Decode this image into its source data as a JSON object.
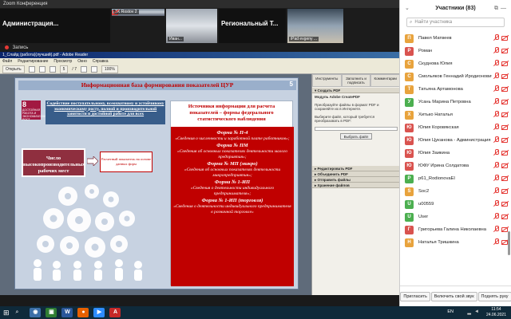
{
  "zoom": {
    "window_title": "Zoom Конференция",
    "tiles": [
      {
        "label": "Администрация...",
        "caption": ""
      },
      {
        "label": "",
        "caption": "TK Rostov 2"
      },
      {
        "label": "",
        "caption": "Иван..."
      },
      {
        "label": "Региональный Т...",
        "caption": ""
      },
      {
        "label": "",
        "caption": "iPad evgeny ..."
      }
    ],
    "recording_label": "Запись"
  },
  "reader": {
    "window_title": "1_Слайд (работа)(лучший).pdf - Adobe Reader",
    "menu": [
      "Файл",
      "Редактирование",
      "Просмотр",
      "Окно",
      "Справка"
    ],
    "toolbar": {
      "open": "Открыть",
      "page": "5",
      "page_total": "/ 7",
      "zoom": "100%"
    },
    "tools_tabs": [
      "Инструменты",
      "Заполнить и подписать",
      "Комментарии"
    ],
    "create_pdf": {
      "header": "▾ Создать PDF",
      "service": "Модуль Adobe CreatePDF",
      "description": "Преобразуйте файлы в формат PDF и сохраняйте их в Интернете.",
      "choose_label": "Выберите файл, который требуется преобразовать в PDF:",
      "button": "Выбрать файл"
    },
    "tool_items": [
      "▸ Редактировать PDF",
      "▸ Объединить PDF",
      "▸ Отправить файлы",
      "▸ Хранение файлов"
    ]
  },
  "slide": {
    "title": "Информационная база формирования показателей ЦУР",
    "number": "5",
    "sdg": {
      "num": "8",
      "text": "ДОСТОЙНАЯ РАБОТА И ЭКОНОМИЧЕСКИЙ РОСТ"
    },
    "goal_text": "Содействие поступательному, всеохватному и устойчивому экономическому росту, полной и производительной занятости и достойной работе для всех",
    "indicator": "Число высокопроизводительных рабочих мест",
    "calc": "Расчетный показатель на основе данных форм",
    "sources_title": "Источники информации для расчета показателей – формы федерального статистического наблюдения",
    "forms": [
      {
        "name": "Форма № П-4",
        "desc": "«Сведения о численности и заработной плате работников»;"
      },
      {
        "name": "Форма № ПМ",
        "desc": "«Сведения об основных показателях деятельности малого предприятия»;"
      },
      {
        "name": "Форма № МП (микро)",
        "desc": "«Сведения об основных показателях деятельности микропредприятия»;"
      },
      {
        "name": "Форма № 1-ИП",
        "desc": "«Сведения о деятельности индивидуального предпринимателя»;"
      },
      {
        "name": "Форма № 1-ИП (торговля)",
        "desc": "«Сведения о деятельности индивидуального предпринимателя в розничной торговле»"
      }
    ]
  },
  "participants": {
    "title": "Участники (83)",
    "search_placeholder": "Найти участника",
    "items": [
      {
        "initial": "П",
        "name": "Павел Матвеев",
        "color": "#e8a33d"
      },
      {
        "initial": "Р",
        "name": "Роман",
        "color": "#d9534f"
      },
      {
        "initial": "С",
        "name": "Скуднова Юлия",
        "color": "#e8a33d"
      },
      {
        "initial": "С",
        "name": "Смольяков Геннадий Иродионович",
        "color": "#e8a33d"
      },
      {
        "initial": "Т",
        "name": "Татьяна Артамонова",
        "color": "#e8a33d"
      },
      {
        "initial": "У",
        "name": "Усань Марина Петровна",
        "color": "#4caf50"
      },
      {
        "initial": "Х",
        "name": "Хитько Наталья",
        "color": "#e8a33d"
      },
      {
        "initial": "Ю",
        "name": "Юлия Коровякская",
        "color": "#d9534f"
      },
      {
        "initial": "Ю",
        "name": "Юлия Цуканова - Администрация ...",
        "color": "#d9534f"
      },
      {
        "initial": "Ю",
        "name": "Юлия Заикина",
        "color": "#d9534f"
      },
      {
        "initial": "Ю",
        "name": "ЮФУ Ирина Солдатова",
        "color": "#d9534f"
      },
      {
        "initial": "P",
        "name": "p61_RodionovaEl",
        "color": "#4caf50"
      },
      {
        "initial": "S",
        "name": "Soc2",
        "color": "#e8a33d"
      },
      {
        "initial": "U",
        "name": "u00559",
        "color": "#4caf50"
      },
      {
        "initial": "U",
        "name": "User",
        "color": "#4caf50"
      },
      {
        "initial": "Г",
        "name": "Григорьева Галина Николаевна",
        "color": "#d9534f"
      },
      {
        "initial": "Н",
        "name": "Наталья Тришкина",
        "color": "#e8a33d"
      }
    ],
    "footer": {
      "invite": "Пригласить",
      "unmute": "Включить свой звук",
      "raise": "Поднять руку"
    }
  },
  "taskbar": {
    "lang": "EN",
    "time": "11:54",
    "date": "24.06.2021",
    "apps": [
      {
        "glyph": "◉",
        "color": "#3c6fa8"
      },
      {
        "glyph": "▣",
        "color": "#2e7d32"
      },
      {
        "glyph": "W",
        "color": "#2b579a"
      },
      {
        "glyph": "●",
        "color": "#e66000"
      },
      {
        "glyph": "▶",
        "color": "#2d8cff"
      },
      {
        "glyph": "A",
        "color": "#c62828"
      }
    ]
  }
}
